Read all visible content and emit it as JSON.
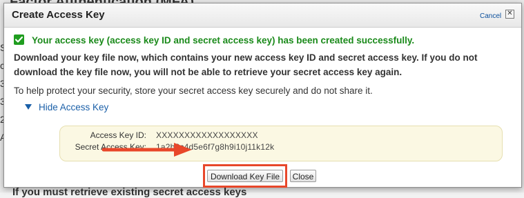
{
  "background": {
    "heading": "Factor Authentication (MFA)",
    "left_fragments": [
      "S",
      "c",
      "3",
      "3",
      "2",
      "A"
    ],
    "bottom_text": "If you must retrieve existing secret access keys"
  },
  "dialog": {
    "title": "Create Access Key",
    "cancel_label": "Cancel",
    "close_glyph": "✕",
    "success_message": "Your access key (access key ID and secret access key) has been created successfully.",
    "download_message": "Download your key file now, which contains your new access key ID and secret access key. If you do not download the key file now, you will not be able to retrieve your secret access key again.",
    "protect_message": "To help protect your security, store your secret access key securely and do not share it.",
    "hide_toggle_label": "Hide Access Key",
    "access_key_id_label": "Access Key ID:",
    "access_key_id_value": "XXXXXXXXXXXXXXXXXX",
    "secret_key_label": "Secret Access Key:",
    "secret_key_value": "1a2b3c4d5e6f7g8h9i10j11k12k",
    "download_button_label": "Download Key File",
    "close_button_label": "Close"
  },
  "colors": {
    "success_green": "#1a8a1a",
    "link_blue": "#1a5fa8",
    "key_box_bg": "#fbf8e3",
    "annotation_red": "#e8472a"
  },
  "icons": {
    "success": "checkmark-icon",
    "toggle": "triangle-down-icon",
    "close": "close-icon",
    "annotation": "arrow-right-icon"
  }
}
